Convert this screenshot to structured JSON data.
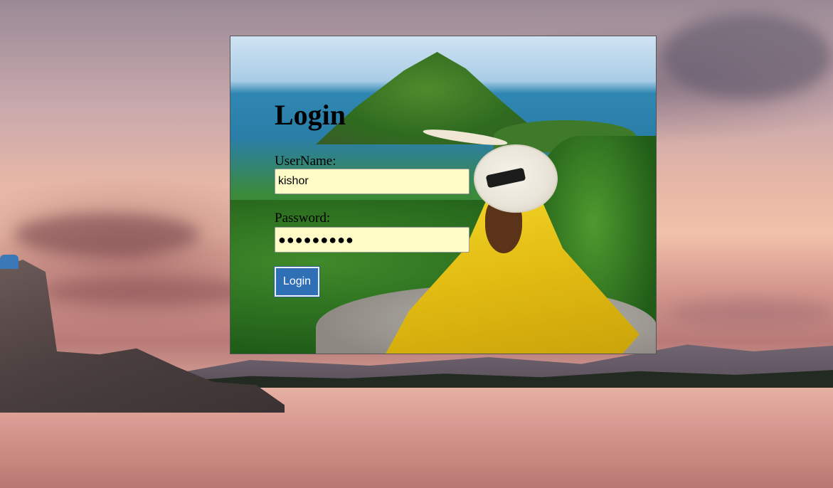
{
  "form": {
    "title": "Login",
    "username_label": "UserName:",
    "username_value": "kishor",
    "password_label": "Password:",
    "password_masked": "●●●●●●●●●",
    "submit_label": "Login"
  },
  "colors": {
    "input_background": "#fffcc8",
    "button_background": "#2f6fb6",
    "button_text": "#ffffff"
  }
}
